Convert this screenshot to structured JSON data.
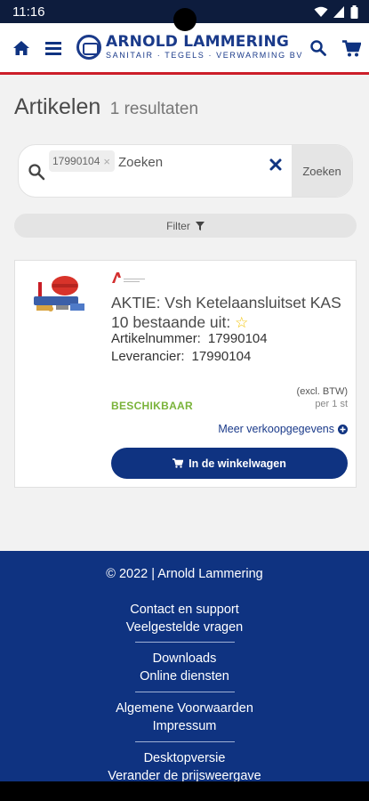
{
  "status": {
    "time": "11:16"
  },
  "header": {
    "logo_title": "ARNOLD LAMMERING",
    "logo_subtitle": "SANITAIR · TEGELS · VERWARMING BV"
  },
  "page": {
    "title": "Artikelen",
    "count": "1 resultaten"
  },
  "search": {
    "chip": "17990104",
    "placeholder": "Zoeken",
    "button": "Zoeken"
  },
  "filter": {
    "label": "Filter"
  },
  "product": {
    "title": "AKTIE: Vsh Ketelaansluitset KAS 10 bestaande uit:",
    "article_label": "Artikelnummer:",
    "article_value": "17990104",
    "supplier_label": "Leverancier:",
    "supplier_value": "17990104",
    "price_note": "(excl. BTW)",
    "price_unit": "per 1 st",
    "availability": "BESCHIKBAAR",
    "more": "Meer verkoopgegevens",
    "cart_button": "In de winkelwagen"
  },
  "footer": {
    "copyright": "© 2022  |  Arnold Lammering",
    "links": [
      "Contact en support",
      "Veelgestelde vragen",
      "Downloads",
      "Online diensten",
      "Algemene Voorwaarden",
      "Impressum",
      "Desktopversie",
      "Verander de prijsweergave"
    ]
  },
  "colors": {
    "brand_blue": "#0f3381",
    "accent_red": "#cc1f2a",
    "available_green": "#7ab33a",
    "star_yellow": "#f2c200"
  }
}
